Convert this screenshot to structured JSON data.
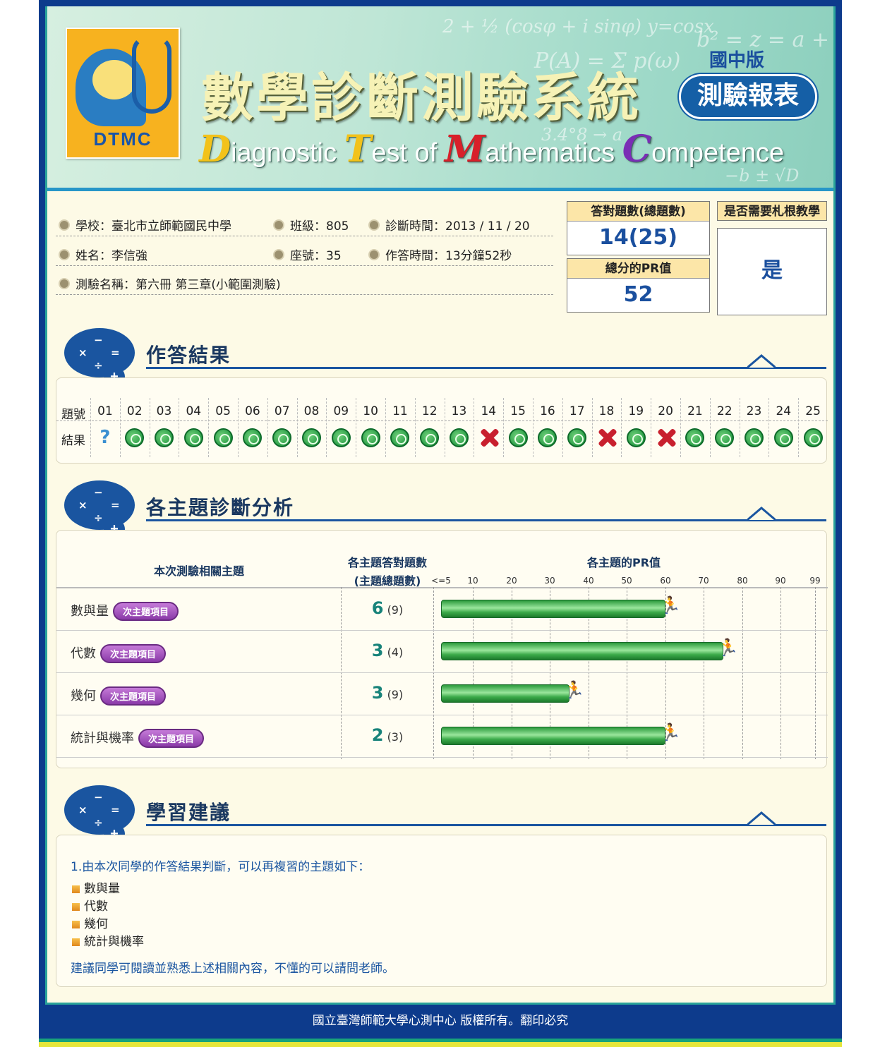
{
  "banner": {
    "logo_text": "DTMC",
    "title_cn": "數學診斷測驗系統",
    "title_en": [
      {
        "cap": "D",
        "rest": "iagnostic "
      },
      {
        "cap": "T",
        "rest": "est of "
      },
      {
        "cap": "M",
        "rest": "athematics "
      },
      {
        "cap": "C",
        "rest": "ompetence"
      }
    ],
    "cap_colors": [
      "#f2c21a",
      "#f2c21a",
      "#d8202a",
      "#7a2eb5"
    ],
    "edition": "國中版",
    "report_label": "測驗報表"
  },
  "info": {
    "school": "學校：臺北市立師範國民中學",
    "class": "班級：805",
    "diagnose_time": "診斷時間：2013 / 11 / 20",
    "name": "姓名：李信強",
    "seat": "座號：35",
    "answer_time": "作答時間：13分鐘52秒",
    "test_name": "測驗名稱：第六冊 第三章(小範圍測驗)"
  },
  "stats": {
    "correct_label": "答對題數(總題數)",
    "correct_value": "14(25)",
    "pr_label": "總分的PR值",
    "pr_value": "52",
    "remedial_label": "是否需要札根教學",
    "remedial_value": "是"
  },
  "sections": {
    "results_title": "作答結果",
    "analysis_title": "各主題診斷分析",
    "advice_title": "學習建議"
  },
  "results": {
    "row_label_no": "題號",
    "row_label_result": "結果",
    "numbers": [
      "01",
      "02",
      "03",
      "04",
      "05",
      "06",
      "07",
      "08",
      "09",
      "10",
      "11",
      "12",
      "13",
      "14",
      "15",
      "16",
      "17",
      "18",
      "19",
      "20",
      "21",
      "22",
      "23",
      "24",
      "25"
    ],
    "outcomes": [
      "unknown",
      "correct",
      "correct",
      "correct",
      "correct",
      "correct",
      "correct",
      "correct",
      "correct",
      "correct",
      "correct",
      "correct",
      "correct",
      "wrong",
      "correct",
      "correct",
      "correct",
      "wrong",
      "correct",
      "wrong",
      "correct",
      "correct",
      "correct",
      "correct",
      "correct"
    ]
  },
  "analysis": {
    "col_topic": "本次測驗相關主題",
    "col_score_line1": "各主題答對題數",
    "col_score_line2": "(主題總題數)",
    "col_pr": "各主題的PR值",
    "pr_ticks": [
      "<=5",
      "10",
      "20",
      "30",
      "40",
      "50",
      "60",
      "70",
      "80",
      "90",
      "99"
    ],
    "pill_label": "次主題項目",
    "topics": [
      {
        "name": "數與量",
        "correct": "6",
        "total": "(9)",
        "pr": 60
      },
      {
        "name": "代數",
        "correct": "3",
        "total": "(4)",
        "pr": 75
      },
      {
        "name": "幾何",
        "correct": "3",
        "total": "(9)",
        "pr": 35
      },
      {
        "name": "統計與機率",
        "correct": "2",
        "total": "(3)",
        "pr": 60
      }
    ]
  },
  "advice": {
    "intro": "1.由本次同學的作答結果判斷，可以再複習的主題如下：",
    "topics": [
      "數與量",
      "代數",
      "幾何",
      "統計與機率"
    ],
    "closing": "建議同學可閱讀並熟悉上述相關內容，不懂的可以請問老師。"
  },
  "footer": {
    "text": "國立臺灣師範大學心測中心 版權所有。翻印必究"
  }
}
